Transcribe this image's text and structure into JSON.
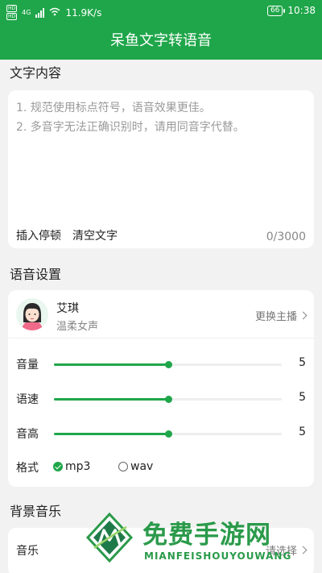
{
  "status_bar": {
    "sim_labels": [
      "HD",
      "HD"
    ],
    "network": "4G",
    "speed": "11.9K/s",
    "battery": "66",
    "time": "10:38"
  },
  "app": {
    "title": "呆鱼文字转语音"
  },
  "text_section": {
    "title": "文字内容",
    "placeholder": "1. 规范使用标点符号，语音效果更佳。\n2. 多音字无法正确识别时，请用同音字代替。",
    "insert_pause": "插入停顿",
    "clear_text": "清空文字",
    "counter": "0/3000"
  },
  "voice_section": {
    "title": "语音设置",
    "anchor_name": "艾琪",
    "anchor_desc": "温柔女声",
    "change_anchor": "更换主播",
    "sliders": [
      {
        "label": "音量",
        "value": "5",
        "fraction": 0.5
      },
      {
        "label": "语速",
        "value": "5",
        "fraction": 0.5
      },
      {
        "label": "音高",
        "value": "5",
        "fraction": 0.5
      }
    ],
    "format_label": "格式",
    "format_options": [
      "mp3",
      "wav"
    ],
    "format_selected": "mp3"
  },
  "music_section": {
    "title": "背景音乐",
    "label": "音乐",
    "select_label": "请选择"
  },
  "watermark": {
    "title": "免费手游网",
    "subtitle": "MIANFEISHOUYOUWANG"
  },
  "colors": {
    "brand": "#1fa64a",
    "track": "#eeeeee",
    "background": "#f2f2f2"
  }
}
